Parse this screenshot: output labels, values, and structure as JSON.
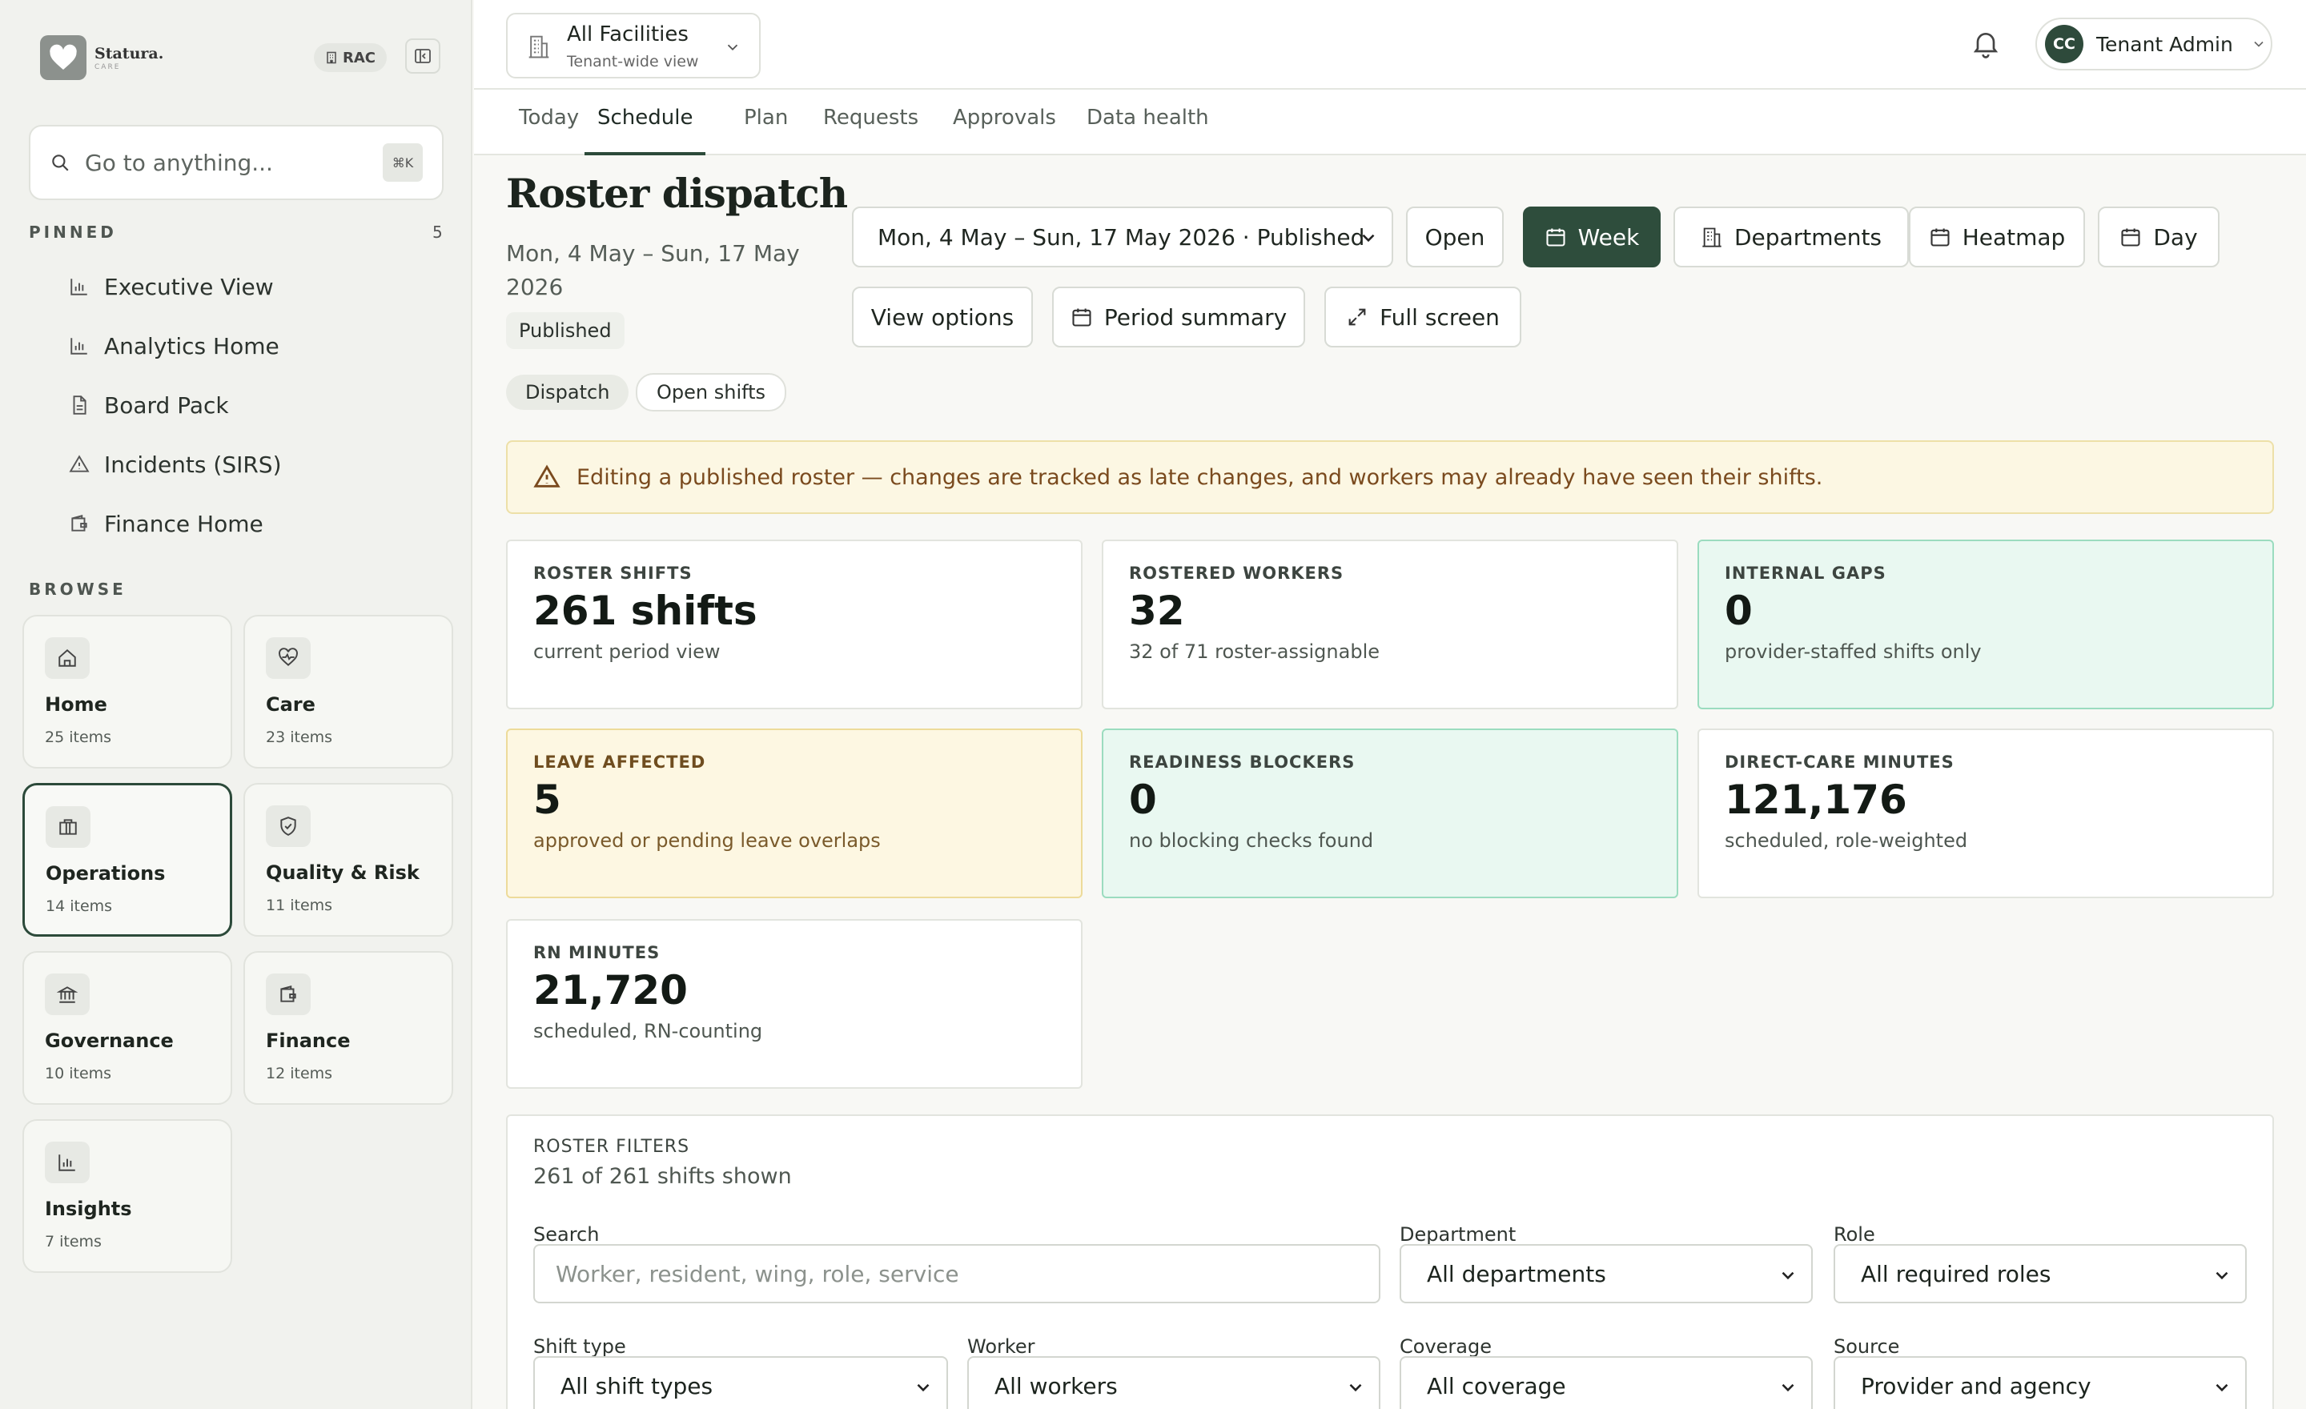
{
  "sidebar": {
    "brand": {
      "name": "Statura.",
      "sub": "CARE"
    },
    "role_badge": "RAC",
    "search": {
      "placeholder": "Go to anything...",
      "shortcut": "⌘K"
    },
    "pinned_label": "PINNED",
    "pinned_count": "5",
    "pinned": [
      {
        "label": "Executive View",
        "icon": "bar-chart-icon"
      },
      {
        "label": "Analytics Home",
        "icon": "bar-chart-icon"
      },
      {
        "label": "Board Pack",
        "icon": "document-icon"
      },
      {
        "label": "Incidents (SIRS)",
        "icon": "warning-icon"
      },
      {
        "label": "Finance Home",
        "icon": "wallet-icon"
      }
    ],
    "browse_label": "BROWSE",
    "cards": [
      {
        "title": "Home",
        "sub": "25 items",
        "icon": "home-icon"
      },
      {
        "title": "Care",
        "sub": "23 items",
        "icon": "heart-pulse-icon"
      },
      {
        "title": "Operations",
        "sub": "14 items",
        "icon": "briefcase-icon",
        "active": true
      },
      {
        "title": "Quality & Risk",
        "sub": "11 items",
        "icon": "shield-check-icon"
      },
      {
        "title": "Governance",
        "sub": "10 items",
        "icon": "landmark-icon"
      },
      {
        "title": "Finance",
        "sub": "12 items",
        "icon": "wallet-icon"
      },
      {
        "title": "Insights",
        "sub": "7 items",
        "icon": "bar-chart-icon"
      }
    ]
  },
  "topbar": {
    "facility": {
      "title": "All Facilities",
      "sub": "Tenant-wide view"
    },
    "user": {
      "initials": "CC",
      "name": "Tenant Admin"
    }
  },
  "tabs": [
    "Today",
    "Schedule",
    "Plan",
    "Requests",
    "Approvals",
    "Data health"
  ],
  "active_tab": "Schedule",
  "page": {
    "title": "Roster dispatch",
    "range": "Mon, 4 May – Sun, 17 May 2026",
    "status": "Published",
    "period_select": "Mon, 4 May – Sun, 17 May 2026 · Published",
    "buttons": {
      "open": "Open",
      "week": "Week",
      "departments": "Departments",
      "heatmap": "Heatmap",
      "day": "Day",
      "view_options": "View options",
      "period_summary": "Period summary",
      "full_screen": "Full screen"
    },
    "subtabs": [
      "Dispatch",
      "Open shifts"
    ],
    "warning": "Editing a published roster — changes are tracked as late changes, and workers may already have seen their shifts."
  },
  "stats": [
    {
      "label": "ROSTER SHIFTS",
      "value": "261 shifts",
      "sub": "current period view",
      "tone": "plain"
    },
    {
      "label": "ROSTERED WORKERS",
      "value": "32",
      "sub": "32 of 71 roster-assignable",
      "tone": "plain"
    },
    {
      "label": "INTERNAL GAPS",
      "value": "0",
      "sub": "provider-staffed shifts only",
      "tone": "green"
    },
    {
      "label": "LEAVE AFFECTED",
      "value": "5",
      "sub": "approved or pending leave overlaps",
      "tone": "amber"
    },
    {
      "label": "READINESS BLOCKERS",
      "value": "0",
      "sub": "no blocking checks found",
      "tone": "green"
    },
    {
      "label": "DIRECT-CARE MINUTES",
      "value": "121,176",
      "sub": "scheduled, role-weighted",
      "tone": "plain"
    },
    {
      "label": "RN MINUTES",
      "value": "21,720",
      "sub": "scheduled, RN-counting",
      "tone": "plain"
    }
  ],
  "filters": {
    "title": "ROSTER FILTERS",
    "count": "261 of 261 shifts shown",
    "search": {
      "label": "Search",
      "placeholder": "Worker, resident, wing, role, service"
    },
    "department": {
      "label": "Department",
      "value": "All departments"
    },
    "role": {
      "label": "Role",
      "value": "All required roles"
    },
    "shift_type": {
      "label": "Shift type",
      "value": "All shift types"
    },
    "worker": {
      "label": "Worker",
      "value": "All workers"
    },
    "coverage": {
      "label": "Coverage",
      "value": "All coverage"
    },
    "source": {
      "label": "Source",
      "value": "Provider and agency"
    }
  },
  "colors": {
    "brand_green": "#2e4d3c",
    "success_bg": "#e9f8f1",
    "warning_bg": "#fcf7e3"
  }
}
